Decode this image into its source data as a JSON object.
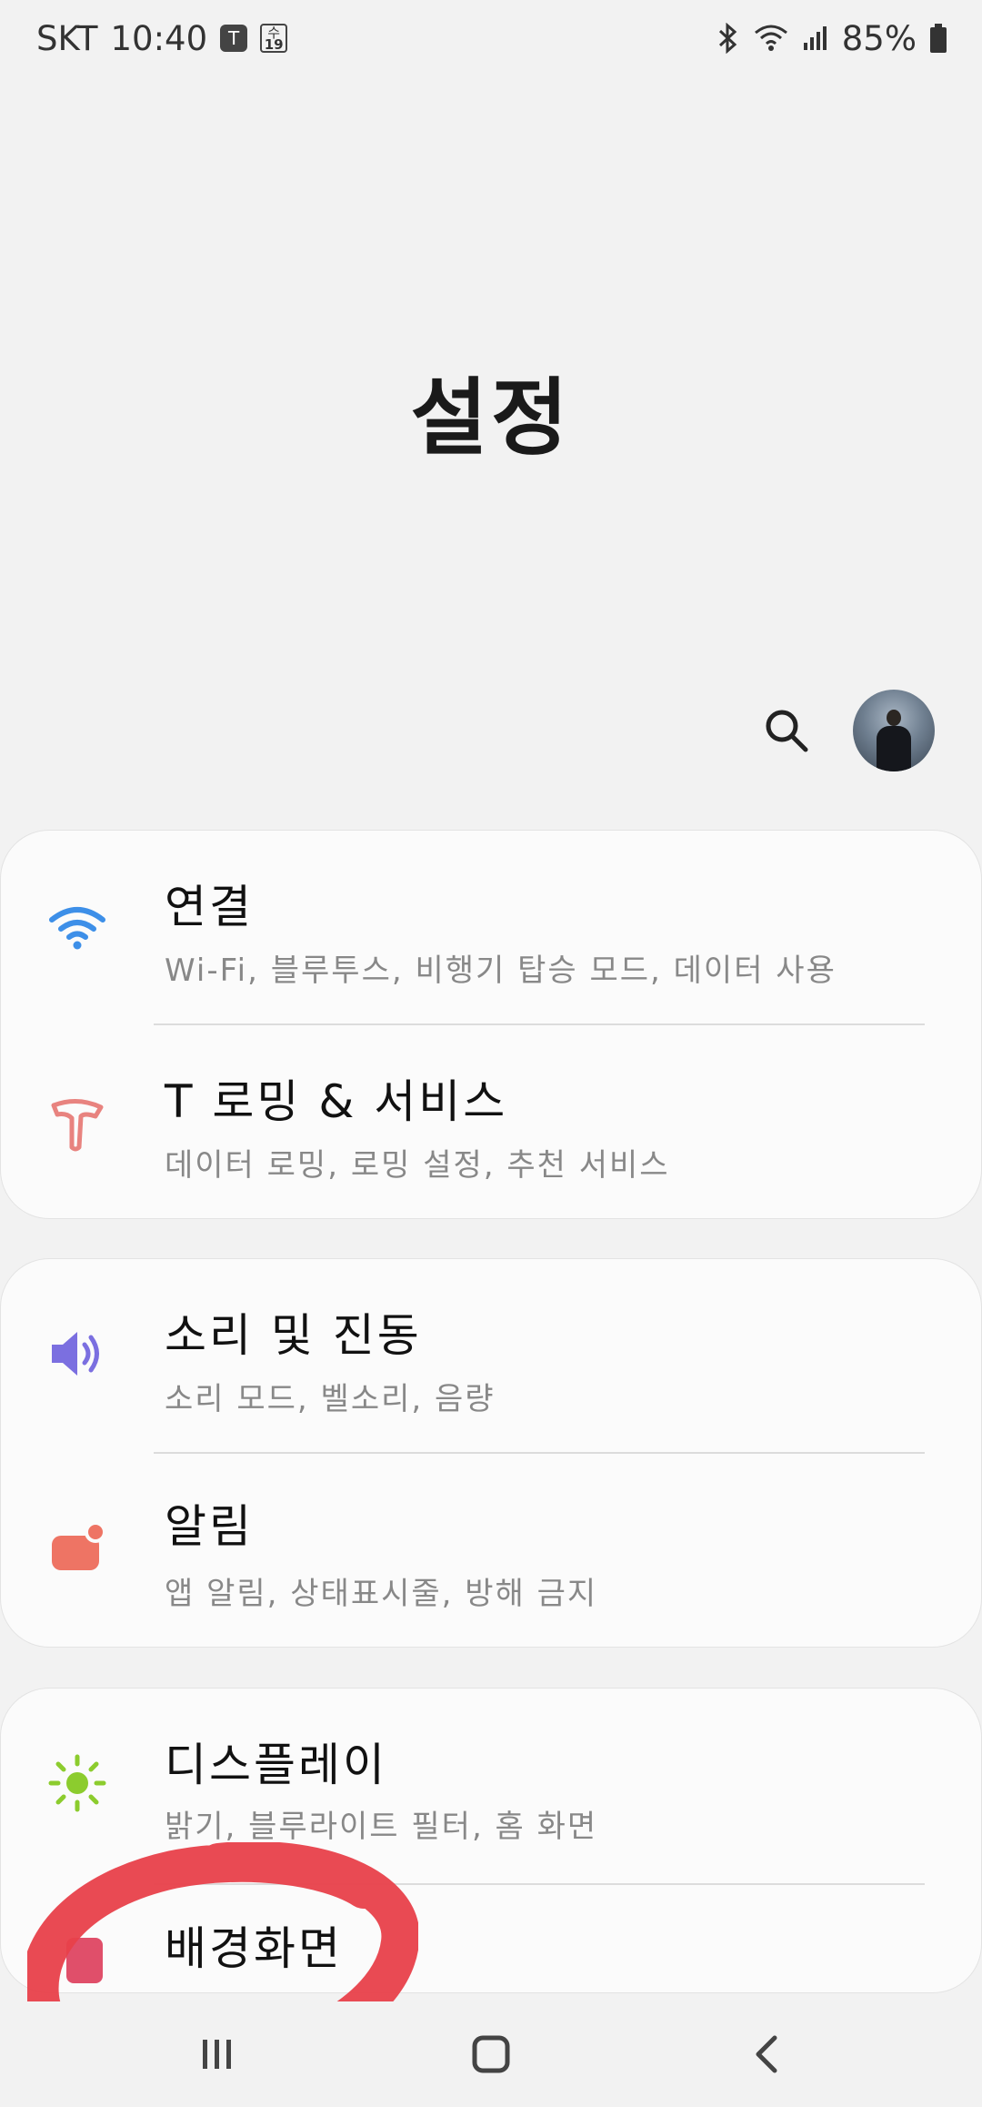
{
  "status_bar": {
    "carrier": "SKT",
    "time": "10:40",
    "calendar_day_label": "수",
    "calendar_date": "19",
    "battery": "85%"
  },
  "page": {
    "title": "설정"
  },
  "sections": [
    {
      "items": [
        {
          "label": "연결",
          "desc": "Wi-Fi, 블루투스, 비행기 탑승 모드, 데이터 사용",
          "icon": "wifi-icon",
          "color": "#3d8fe8"
        },
        {
          "label": "T 로밍 & 서비스",
          "desc": "데이터 로밍, 로밍 설정, 추천 서비스",
          "icon": "t-logo-icon",
          "color": "#e8837f"
        }
      ]
    },
    {
      "items": [
        {
          "label": "소리 및 진동",
          "desc": "소리 모드, 벨소리, 음량",
          "icon": "speaker-icon",
          "color": "#7b6fe0"
        },
        {
          "label": "알림",
          "desc": "앱 알림, 상태표시줄, 방해 금지",
          "icon": "notification-icon",
          "color": "#ee7464"
        }
      ]
    },
    {
      "items": [
        {
          "label": "디스플레이",
          "desc": "밝기, 블루라이트 필터, 홈 화면",
          "icon": "brightness-icon",
          "color": "#8ccc2e"
        },
        {
          "label": "배경화면",
          "desc": "",
          "icon": "wallpaper-icon",
          "color": "#e04f6a"
        }
      ]
    }
  ],
  "annotation_color": "#e8404a"
}
